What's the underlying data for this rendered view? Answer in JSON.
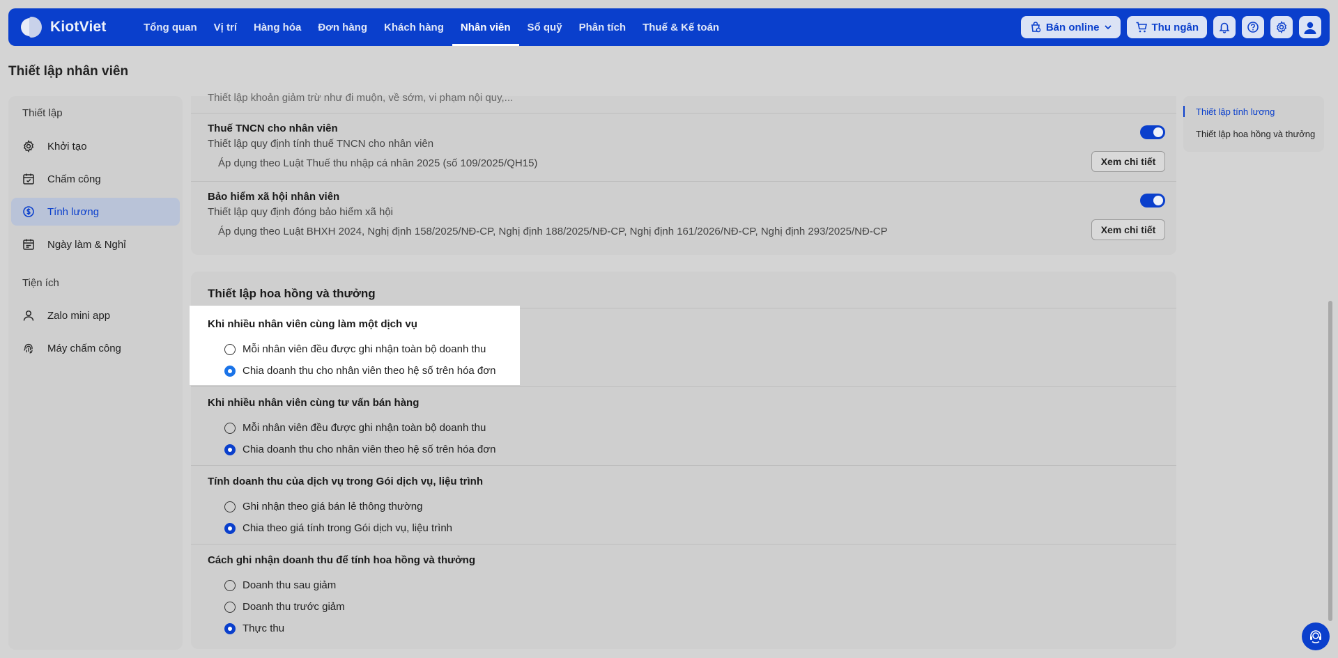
{
  "app": {
    "name": "KiotViet"
  },
  "nav": {
    "items": [
      {
        "label": "Tổng quan",
        "active": false
      },
      {
        "label": "Vị trí",
        "active": false
      },
      {
        "label": "Hàng hóa",
        "active": false
      },
      {
        "label": "Đơn hàng",
        "active": false
      },
      {
        "label": "Khách hàng",
        "active": false
      },
      {
        "label": "Nhân viên",
        "active": true
      },
      {
        "label": "Sổ quỹ",
        "active": false
      },
      {
        "label": "Phân tích",
        "active": false
      },
      {
        "label": "Thuế & Kế toán",
        "active": false
      }
    ],
    "ban_online": "Bán online",
    "thu_ngan": "Thu ngân"
  },
  "page": {
    "title": "Thiết lập nhân viên"
  },
  "sidebar": {
    "group1": "Thiết lập",
    "items1": [
      {
        "label": "Khởi tạo",
        "icon": "gear-icon"
      },
      {
        "label": "Chấm công",
        "icon": "calendar-check-icon"
      },
      {
        "label": "Tính lương",
        "icon": "dollar-circle-icon",
        "active": true
      },
      {
        "label": "Ngày làm & Nghỉ",
        "icon": "calendar-icon"
      }
    ],
    "group2": "Tiện ích",
    "items2": [
      {
        "label": "Zalo mini app",
        "icon": "user-icon"
      },
      {
        "label": "Máy chấm công",
        "icon": "fingerprint-icon"
      }
    ]
  },
  "salary": {
    "deduction_sub": "Thiết lập khoản giảm trừ như đi muộn, về sớm, vi phạm nội quy,...",
    "tax": {
      "title": "Thuế TNCN cho nhân viên",
      "sub": "Thiết lập quy định tính thuế TNCN cho nhân viên",
      "note": "Áp dụng theo Luật Thuế thu nhập cá nhân 2025 (số 109/2025/QH15)",
      "button": "Xem chi tiết",
      "enabled": true
    },
    "insurance": {
      "title": "Bảo hiểm xã hội nhân viên",
      "sub": "Thiết lập quy định đóng bảo hiểm xã hội",
      "note": "Áp dụng theo Luật BHXH 2024, Nghị định 158/2025/NĐ-CP, Nghị định 188/2025/NĐ-CP, Nghị định 161/2026/NĐ-CP, Nghị định 293/2025/NĐ-CP",
      "button": "Xem chi tiết",
      "enabled": true
    }
  },
  "commission": {
    "title": "Thiết lập hoa hồng và thưởng",
    "questions": [
      {
        "label": "Khi nhiều nhân viên cùng làm một dịch vụ",
        "options": [
          "Mỗi nhân viên đều được ghi nhận toàn bộ doanh thu",
          "Chia doanh thu cho nhân viên theo hệ số trên hóa đơn"
        ],
        "selected": 1
      },
      {
        "label": "Khi nhiều nhân viên cùng tư vấn bán hàng",
        "options": [
          "Mỗi nhân viên đều được ghi nhận toàn bộ doanh thu",
          "Chia doanh thu cho nhân viên theo hệ số trên hóa đơn"
        ],
        "selected": 1
      },
      {
        "label": "Tính doanh thu của dịch vụ trong Gói dịch vụ, liệu trình",
        "options": [
          "Ghi nhận theo giá bán lẻ thông thường",
          "Chia theo giá tính trong Gói dịch vụ, liệu trình"
        ],
        "selected": 1
      },
      {
        "label": "Cách ghi nhận doanh thu để tính hoa hồng và thưởng",
        "options": [
          "Doanh thu sau giảm",
          "Doanh thu trước giảm",
          "Thực thu"
        ],
        "selected": 2
      }
    ]
  },
  "anchors": [
    {
      "label": "Thiết lập tính lương",
      "active": true
    },
    {
      "label": "Thiết lập hoa hồng và thưởng",
      "active": false
    }
  ],
  "colors": {
    "brand": "#0a3fcc",
    "background": "#d4d4d4"
  }
}
